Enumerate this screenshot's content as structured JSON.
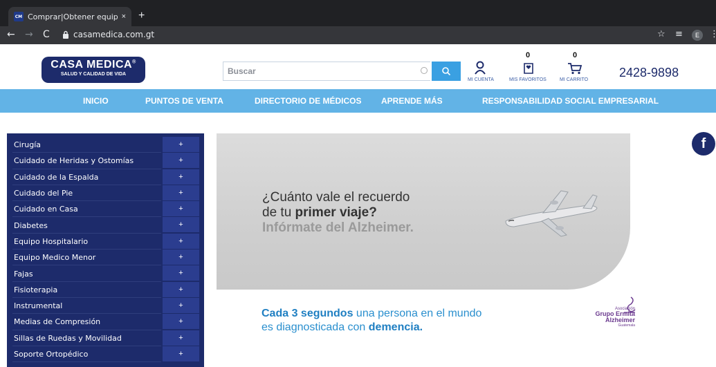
{
  "browser": {
    "tab_favicon": "CM",
    "tab_title": "Comprar|Obtener equipo médic",
    "tab_close": "×",
    "new_tab": "+",
    "url": "casamedica.com.gt",
    "profile_initial": "E"
  },
  "header": {
    "logo_title": "CASA MEDICA",
    "logo_reg": "®",
    "logo_subtitle": "SALUD Y CALIDAD DE VIDA",
    "search_placeholder": "Buscar",
    "account_label": "MI CUENTA",
    "favorites_count": "0",
    "favorites_label": "MIS FAVORITOS",
    "cart_count": "0",
    "cart_label": "MI CARRITO",
    "phone": "2428-9898"
  },
  "nav": {
    "items": [
      "INICIO",
      "PUNTOS DE VENTA",
      "DIRECTORIO DE MÉDICOS",
      "APRENDE MÁS",
      "RESPONSABILIDAD SOCIAL EMPRESARIAL"
    ]
  },
  "sidebar": {
    "plus": "+",
    "items": [
      "Cirugía",
      "Cuidado de Heridas y Ostomías",
      "Cuidado de la Espalda",
      "Cuidado del Pie",
      "Cuidado en Casa",
      "Diabetes",
      "Equipo Hospitalario",
      "Equipo Medico Menor",
      "Fajas",
      "Fisioterapia",
      "Instrumental",
      "Medias de Compresión",
      "Sillas de Ruedas y Movilidad",
      "Soporte Ortopédico"
    ]
  },
  "banner": {
    "line1": "¿Cuánto vale el recuerdo",
    "line2_a": "de tu ",
    "line2_b": "primer viaje?",
    "line3": "Infórmate del Alzheimer."
  },
  "tagline": {
    "a": "Cada 3 segundos",
    "b": " una persona en el mundo",
    "c": "es diagnosticada con ",
    "d": "demencia."
  },
  "sponsor": {
    "small": "Asociación",
    "line1": "Grupo Ermita",
    "line2": "Alzheimer",
    "country": "Guatemala"
  },
  "social": {
    "facebook": "f"
  },
  "colors": {
    "brand_navy": "#1d2b6b",
    "nav_blue": "#62b3e6",
    "accent": "#3aa0e2"
  }
}
